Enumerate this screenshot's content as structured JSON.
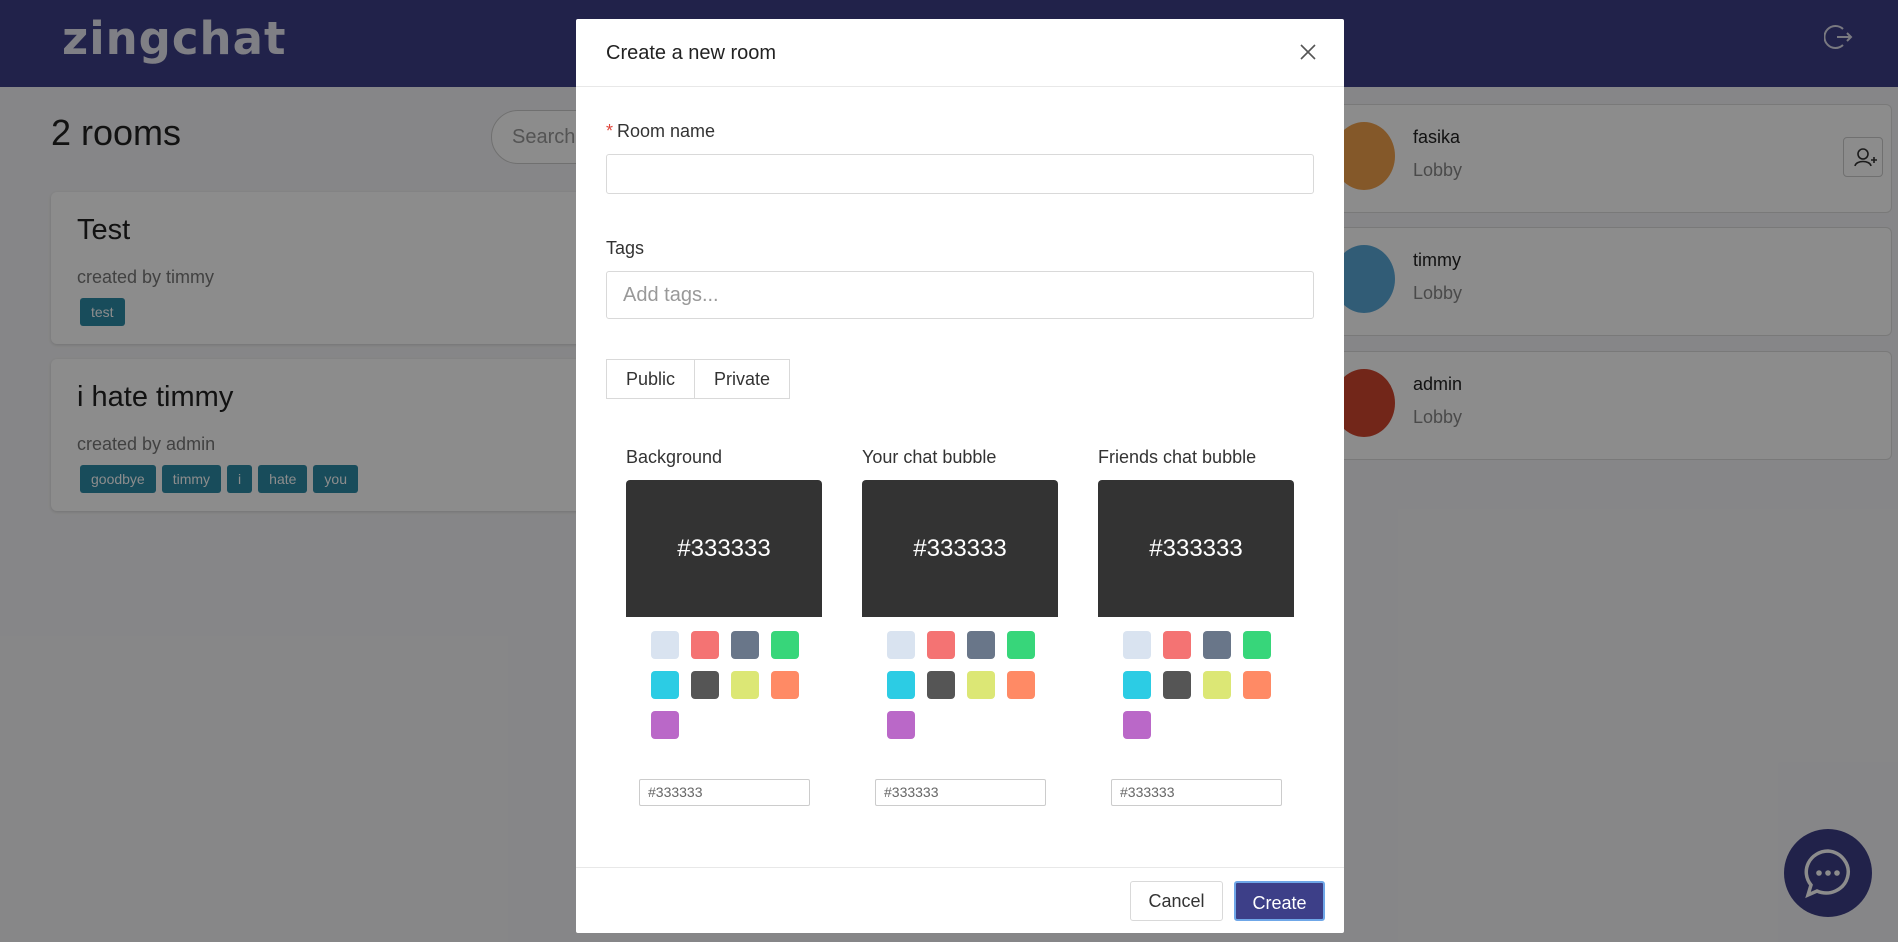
{
  "app": {
    "logo": "zingchat"
  },
  "rooms_page": {
    "title": "2 rooms",
    "search_placeholder": "Search",
    "rooms": [
      {
        "name": "Test",
        "created_by": "created by timmy",
        "tags": [
          "test"
        ]
      },
      {
        "name": "i hate timmy",
        "created_by": "created by admin",
        "tags": [
          "goodbye",
          "timmy",
          "i",
          "hate",
          "you"
        ]
      }
    ]
  },
  "users": [
    {
      "name": "fasika",
      "status": "Lobby"
    },
    {
      "name": "timmy",
      "status": "Lobby"
    },
    {
      "name": "admin",
      "status": "Lobby"
    }
  ],
  "modal": {
    "title": "Create a new room",
    "room_name_label": "Room name",
    "room_name_required_mark": "*",
    "tags_label": "Tags",
    "tags_placeholder": "Add tags...",
    "visibility": {
      "options": [
        "Public",
        "Private"
      ]
    },
    "pickers": [
      {
        "label": "Background",
        "value": "#333333"
      },
      {
        "label": "Your chat bubble",
        "value": "#333333"
      },
      {
        "label": "Friends chat bubble",
        "value": "#333333"
      }
    ],
    "swatch_colors": [
      "#d9e3f0",
      "#f47373",
      "#697689",
      "#37d67a",
      "#2ccce4",
      "#555555",
      "#dce775",
      "#ff8a65",
      "#ba68c8"
    ],
    "cancel_label": "Cancel",
    "create_label": "Create"
  },
  "colors": {
    "brand": "#3d3f88",
    "tag": "#2c8aa6"
  }
}
